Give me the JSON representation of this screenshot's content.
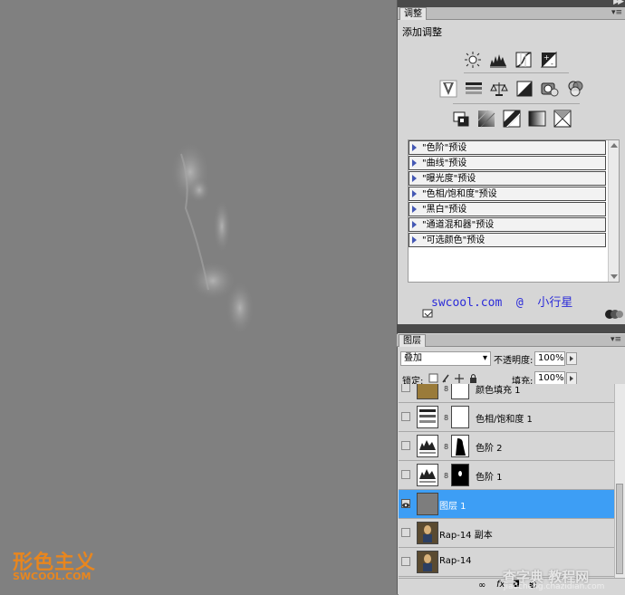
{
  "canvas": {
    "watermark_cn": "形色主义",
    "watermark_en": "SWCOOL.COM"
  },
  "adjustments_panel": {
    "tab_label": "调整",
    "menu_icon": "panel-menu-icon",
    "title": "添加调整",
    "row1_icons": [
      "brightness-contrast-icon",
      "levels-icon",
      "curves-icon",
      "exposure-icon"
    ],
    "row2_icons": [
      "vibrance-icon",
      "hue-saturation-icon",
      "color-balance-icon",
      "black-white-icon",
      "photo-filter-icon",
      "channel-mixer-icon"
    ],
    "row3_icons": [
      "invert-icon",
      "posterize-icon",
      "threshold-icon",
      "gradient-map-icon",
      "selective-color-icon"
    ],
    "presets": [
      "\"色阶\"预设",
      "\"曲线\"预设",
      "\"曝光度\"预设",
      "\"色相/饱和度\"预设",
      "\"黑白\"预设",
      "\"通道混和器\"预设",
      "\"可选颜色\"预设"
    ],
    "credit_text": "swcool.com  @  小行星"
  },
  "layers_panel": {
    "tab_label": "图层",
    "blend_mode": "叠加",
    "opacity_label": "不透明度:",
    "opacity_value": "100%",
    "lock_label": "锁定:",
    "fill_label": "填充:",
    "fill_value": "100%",
    "layers": [
      {
        "name": "颜色填充 1",
        "type": "fill",
        "visible": false,
        "selected": false
      },
      {
        "name": "色相/饱和度 1",
        "type": "adjustment",
        "visible": false,
        "selected": false
      },
      {
        "name": "色阶 2",
        "type": "adjustment",
        "visible": false,
        "selected": false
      },
      {
        "name": "色阶 1",
        "type": "adjustment",
        "visible": false,
        "selected": false
      },
      {
        "name": "图层 1",
        "type": "pixel",
        "visible": true,
        "selected": true
      },
      {
        "name": "Rap-14 副本",
        "type": "photo",
        "visible": false,
        "selected": false
      },
      {
        "name": "Rap-14",
        "type": "photo",
        "visible": false,
        "selected": false
      }
    ],
    "footer_icons": [
      "link-layers-icon",
      "fx-icon",
      "add-mask-icon",
      "new-adjustment-icon",
      "new-group-icon",
      "new-layer-icon",
      "delete-layer-icon"
    ]
  },
  "site_watermark": {
    "text": "查字典 教程网",
    "url": "jiaocheng.chazidian.com"
  },
  "colors": {
    "selection": "#3d9ef5",
    "credit": "#2b2bd8",
    "watermark": "#e8861e"
  }
}
